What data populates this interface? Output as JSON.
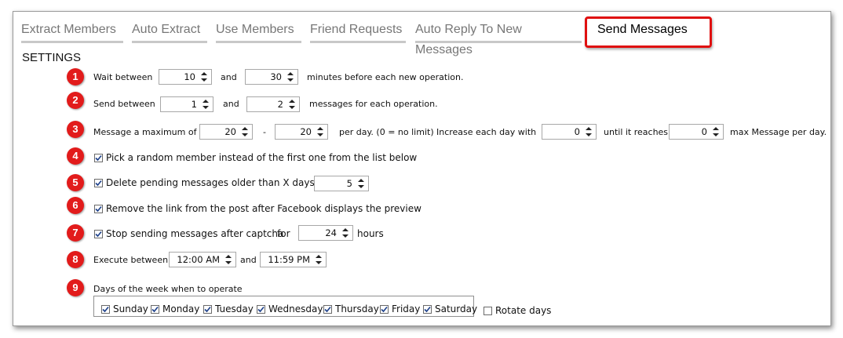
{
  "tabs": [
    {
      "label": "Extract Members"
    },
    {
      "label": "Auto Extract"
    },
    {
      "label": "Use Members"
    },
    {
      "label": "Friend Requests"
    },
    {
      "label": "Auto Reply To New Messages"
    },
    {
      "label": "Send Messages"
    }
  ],
  "active_tab": "Send Messages",
  "settings_title": "SETTINGS",
  "badges": [
    "1",
    "2",
    "3",
    "4",
    "5",
    "6",
    "7",
    "8",
    "9"
  ],
  "row1": {
    "prefix": "Wait between",
    "from": "10",
    "and": "and",
    "to": "30",
    "suffix": "minutes before each new operation."
  },
  "row2": {
    "prefix": "Send between",
    "from": "1",
    "and": "and",
    "to": "2",
    "suffix": "messages for each operation."
  },
  "row3": {
    "prefix": "Message a maximum of",
    "min": "20",
    "dash": "-",
    "max": "20",
    "per_day": "per day. (0 = no limit)",
    "increase": "Increase each day with",
    "increase_val": "0",
    "until": "until it reaches",
    "until_val": "0",
    "suffix": "max Message per day."
  },
  "row4": {
    "label": "Pick a random member instead of the first one from the list below",
    "checked": true
  },
  "row5": {
    "label": "Delete pending messages older than X days",
    "checked": true,
    "days": "5"
  },
  "row6": {
    "label": "Remove the link from the post after Facebook displays the preview",
    "checked": true
  },
  "row7": {
    "label": "Stop sending messages after captcha",
    "checked": true,
    "for": "for",
    "hours_val": "24",
    "hours": "hours"
  },
  "row8": {
    "prefix": "Execute between",
    "start": "12:00 AM",
    "and": "and",
    "end": "11:59 PM"
  },
  "row9": {
    "title": "Days of the week when to operate",
    "days": [
      {
        "label": "Sunday",
        "checked": true
      },
      {
        "label": "Monday",
        "checked": true
      },
      {
        "label": "Tuesday",
        "checked": true
      },
      {
        "label": "Wednesday",
        "checked": true
      },
      {
        "label": "Thursday",
        "checked": true
      },
      {
        "label": "Friday",
        "checked": true
      },
      {
        "label": "Saturday",
        "checked": true
      }
    ],
    "rotate": {
      "label": "Rotate days",
      "checked": false
    }
  },
  "colors": {
    "highlight": "#e01010",
    "badge": "#e21b1b"
  }
}
